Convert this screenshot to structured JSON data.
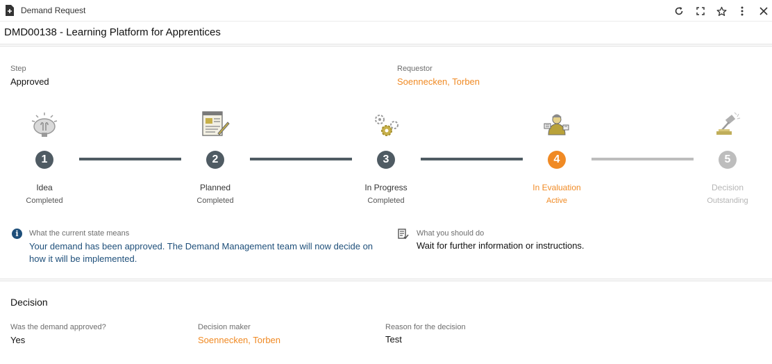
{
  "window": {
    "title": "Demand Request",
    "record_title": "DMD00138 - Learning Platform for Apprentices"
  },
  "header_fields": {
    "step_label": "Step",
    "step_value": "Approved",
    "requestor_label": "Requestor",
    "requestor_value": "Soennecken, Torben"
  },
  "stages": [
    {
      "number": "1",
      "name": "Idea",
      "status": "Completed",
      "state": "completed",
      "icon": "lightbulb-icon"
    },
    {
      "number": "2",
      "name": "Planned",
      "status": "Completed",
      "state": "completed",
      "icon": "planning-document-icon"
    },
    {
      "number": "3",
      "name": "In Progress",
      "status": "Completed",
      "state": "completed",
      "icon": "gears-icon"
    },
    {
      "number": "4",
      "name": "In Evaluation",
      "status": "Active",
      "state": "active",
      "icon": "evaluation-worker-icon"
    },
    {
      "number": "5",
      "name": "Decision",
      "status": "Outstanding",
      "state": "outstanding",
      "icon": "gavel-icon"
    }
  ],
  "colors": {
    "completed": "#4f5b63",
    "active": "#f08a24",
    "outstanding": "#bdbdbd",
    "link": "#f08a24",
    "info": "#1e4f7a"
  },
  "state_info": {
    "meaning_label": "What the current state means",
    "meaning_text": "Your demand has been approved. The Demand Management team will now decide on how it will be implemented.",
    "todo_label": "What you should do",
    "todo_text": "Wait for further information or instructions."
  },
  "decision": {
    "section_title": "Decision",
    "approved_label": "Was the demand approved?",
    "approved_value": "Yes",
    "maker_label": "Decision maker",
    "maker_value": "Soennecken, Torben",
    "reason_label": "Reason for the decision",
    "reason_value": "Test"
  }
}
